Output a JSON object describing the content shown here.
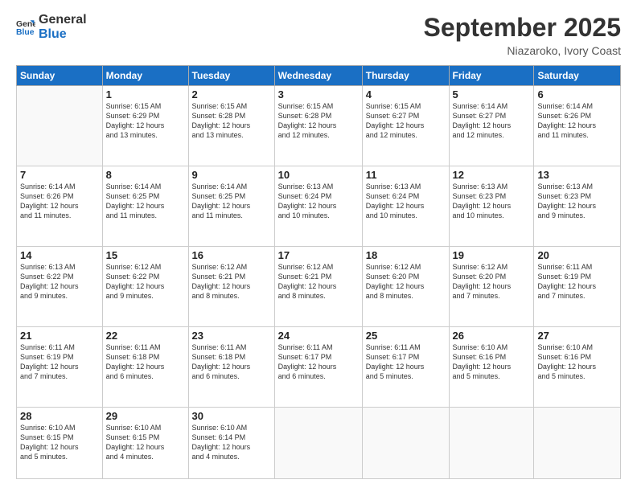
{
  "header": {
    "logo_line1": "General",
    "logo_line2": "Blue",
    "month": "September 2025",
    "location": "Niazaroko, Ivory Coast"
  },
  "weekdays": [
    "Sunday",
    "Monday",
    "Tuesday",
    "Wednesday",
    "Thursday",
    "Friday",
    "Saturday"
  ],
  "weeks": [
    [
      {
        "day": "",
        "info": ""
      },
      {
        "day": "1",
        "info": "Sunrise: 6:15 AM\nSunset: 6:29 PM\nDaylight: 12 hours\nand 13 minutes."
      },
      {
        "day": "2",
        "info": "Sunrise: 6:15 AM\nSunset: 6:28 PM\nDaylight: 12 hours\nand 13 minutes."
      },
      {
        "day": "3",
        "info": "Sunrise: 6:15 AM\nSunset: 6:28 PM\nDaylight: 12 hours\nand 12 minutes."
      },
      {
        "day": "4",
        "info": "Sunrise: 6:15 AM\nSunset: 6:27 PM\nDaylight: 12 hours\nand 12 minutes."
      },
      {
        "day": "5",
        "info": "Sunrise: 6:14 AM\nSunset: 6:27 PM\nDaylight: 12 hours\nand 12 minutes."
      },
      {
        "day": "6",
        "info": "Sunrise: 6:14 AM\nSunset: 6:26 PM\nDaylight: 12 hours\nand 11 minutes."
      }
    ],
    [
      {
        "day": "7",
        "info": "Sunrise: 6:14 AM\nSunset: 6:26 PM\nDaylight: 12 hours\nand 11 minutes."
      },
      {
        "day": "8",
        "info": "Sunrise: 6:14 AM\nSunset: 6:25 PM\nDaylight: 12 hours\nand 11 minutes."
      },
      {
        "day": "9",
        "info": "Sunrise: 6:14 AM\nSunset: 6:25 PM\nDaylight: 12 hours\nand 11 minutes."
      },
      {
        "day": "10",
        "info": "Sunrise: 6:13 AM\nSunset: 6:24 PM\nDaylight: 12 hours\nand 10 minutes."
      },
      {
        "day": "11",
        "info": "Sunrise: 6:13 AM\nSunset: 6:24 PM\nDaylight: 12 hours\nand 10 minutes."
      },
      {
        "day": "12",
        "info": "Sunrise: 6:13 AM\nSunset: 6:23 PM\nDaylight: 12 hours\nand 10 minutes."
      },
      {
        "day": "13",
        "info": "Sunrise: 6:13 AM\nSunset: 6:23 PM\nDaylight: 12 hours\nand 9 minutes."
      }
    ],
    [
      {
        "day": "14",
        "info": "Sunrise: 6:13 AM\nSunset: 6:22 PM\nDaylight: 12 hours\nand 9 minutes."
      },
      {
        "day": "15",
        "info": "Sunrise: 6:12 AM\nSunset: 6:22 PM\nDaylight: 12 hours\nand 9 minutes."
      },
      {
        "day": "16",
        "info": "Sunrise: 6:12 AM\nSunset: 6:21 PM\nDaylight: 12 hours\nand 8 minutes."
      },
      {
        "day": "17",
        "info": "Sunrise: 6:12 AM\nSunset: 6:21 PM\nDaylight: 12 hours\nand 8 minutes."
      },
      {
        "day": "18",
        "info": "Sunrise: 6:12 AM\nSunset: 6:20 PM\nDaylight: 12 hours\nand 8 minutes."
      },
      {
        "day": "19",
        "info": "Sunrise: 6:12 AM\nSunset: 6:20 PM\nDaylight: 12 hours\nand 7 minutes."
      },
      {
        "day": "20",
        "info": "Sunrise: 6:11 AM\nSunset: 6:19 PM\nDaylight: 12 hours\nand 7 minutes."
      }
    ],
    [
      {
        "day": "21",
        "info": "Sunrise: 6:11 AM\nSunset: 6:19 PM\nDaylight: 12 hours\nand 7 minutes."
      },
      {
        "day": "22",
        "info": "Sunrise: 6:11 AM\nSunset: 6:18 PM\nDaylight: 12 hours\nand 6 minutes."
      },
      {
        "day": "23",
        "info": "Sunrise: 6:11 AM\nSunset: 6:18 PM\nDaylight: 12 hours\nand 6 minutes."
      },
      {
        "day": "24",
        "info": "Sunrise: 6:11 AM\nSunset: 6:17 PM\nDaylight: 12 hours\nand 6 minutes."
      },
      {
        "day": "25",
        "info": "Sunrise: 6:11 AM\nSunset: 6:17 PM\nDaylight: 12 hours\nand 5 minutes."
      },
      {
        "day": "26",
        "info": "Sunrise: 6:10 AM\nSunset: 6:16 PM\nDaylight: 12 hours\nand 5 minutes."
      },
      {
        "day": "27",
        "info": "Sunrise: 6:10 AM\nSunset: 6:16 PM\nDaylight: 12 hours\nand 5 minutes."
      }
    ],
    [
      {
        "day": "28",
        "info": "Sunrise: 6:10 AM\nSunset: 6:15 PM\nDaylight: 12 hours\nand 5 minutes."
      },
      {
        "day": "29",
        "info": "Sunrise: 6:10 AM\nSunset: 6:15 PM\nDaylight: 12 hours\nand 4 minutes."
      },
      {
        "day": "30",
        "info": "Sunrise: 6:10 AM\nSunset: 6:14 PM\nDaylight: 12 hours\nand 4 minutes."
      },
      {
        "day": "",
        "info": ""
      },
      {
        "day": "",
        "info": ""
      },
      {
        "day": "",
        "info": ""
      },
      {
        "day": "",
        "info": ""
      }
    ]
  ]
}
